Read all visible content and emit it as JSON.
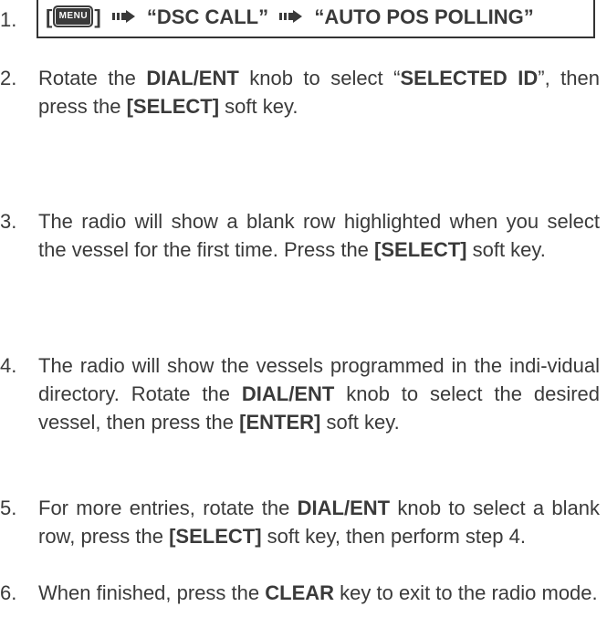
{
  "step1": {
    "number": "1.",
    "bracket_open": "[",
    "menu_key": "MENU",
    "bracket_close": "]",
    "q1": "“DSC CALL”",
    "q2": "“AUTO POS POLLING”"
  },
  "step2": {
    "number": "2.",
    "t1": "Rotate the ",
    "b1": "DIAL/ENT",
    "t2": " knob to select “",
    "b2": "SELECTED ID",
    "t3": "”, then press the ",
    "b3": "[SELECT]",
    "t4": " soft key."
  },
  "step3": {
    "number": "3.",
    "t1": "The radio will show a blank row highlighted when you select the vessel for the first time. Press the ",
    "b1": "[SELECT]",
    "t2": " soft key."
  },
  "step4": {
    "number": "4.",
    "t1": "The radio will show the vessels programmed in the indi-vidual directory. Rotate the ",
    "b1": "DIAL/ENT",
    "t2": " knob to select the desired vessel, then press the ",
    "b2": "[ENTER]",
    "t3": " soft key."
  },
  "step5": {
    "number": "5.",
    "t1": "For more entries, rotate the ",
    "b1": "DIAL/ENT",
    "t2": " knob to select a blank row, press the ",
    "b2": "[SELECT]",
    "t3": " soft key, then perform step 4."
  },
  "step6": {
    "number": "6.",
    "t1": "When finished, press the ",
    "b1": "CLEAR",
    "t2": " key to exit to the radio mode."
  },
  "icons": {
    "menu": "menu-key-icon",
    "arrow": "right-arrow-icon"
  }
}
